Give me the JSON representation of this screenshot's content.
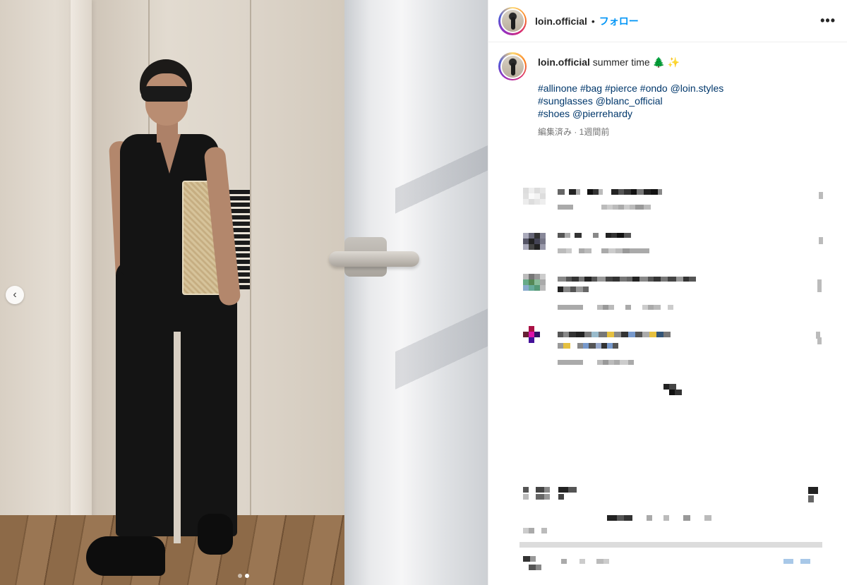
{
  "post": {
    "username": "loin.official",
    "separator": "•",
    "follow_label": "フォロー",
    "more_label": "•••",
    "caption_user": "loin.official",
    "caption_text": "summer time 🌲 ✨",
    "tags_line1": "#allinone #bag #pierce #ondo @loin.styles",
    "tags_line2": "#sunglasses @blanc_official",
    "tags_line3": "#shoes @pierrehardy",
    "meta": "編集済み · 1週間前",
    "carousel_prev": "‹",
    "slide_count": 2,
    "active_slide": 2
  },
  "icons": {
    "avatar": "profile-avatar-icon",
    "more": "more-options-icon",
    "prev": "chevron-left-icon"
  },
  "colors": {
    "follow": "#0095f6",
    "tag_link": "#00376b",
    "meta": "#737373",
    "story_ring": [
      "#feda75",
      "#fa7e1e",
      "#d62976",
      "#962fbf",
      "#4f5bd5"
    ]
  }
}
